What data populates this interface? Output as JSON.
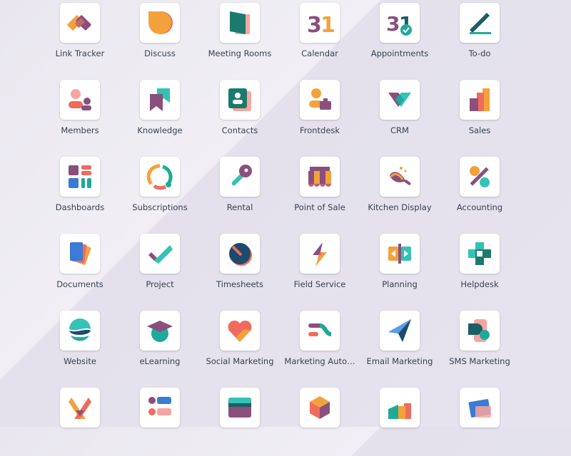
{
  "apps": [
    {
      "label": "Link Tracker",
      "icon": "link-tracker-icon"
    },
    {
      "label": "Discuss",
      "icon": "discuss-icon"
    },
    {
      "label": "Meeting Rooms",
      "icon": "meeting-rooms-icon"
    },
    {
      "label": "Calendar",
      "icon": "calendar-icon"
    },
    {
      "label": "Appointments",
      "icon": "appointments-icon"
    },
    {
      "label": "To-do",
      "icon": "todo-icon"
    },
    {
      "label": "Members",
      "icon": "members-icon"
    },
    {
      "label": "Knowledge",
      "icon": "knowledge-icon"
    },
    {
      "label": "Contacts",
      "icon": "contacts-icon"
    },
    {
      "label": "Frontdesk",
      "icon": "frontdesk-icon"
    },
    {
      "label": "CRM",
      "icon": "crm-icon"
    },
    {
      "label": "Sales",
      "icon": "sales-icon"
    },
    {
      "label": "Dashboards",
      "icon": "dashboards-icon"
    },
    {
      "label": "Subscriptions",
      "icon": "subscriptions-icon"
    },
    {
      "label": "Rental",
      "icon": "rental-icon"
    },
    {
      "label": "Point of Sale",
      "icon": "point-of-sale-icon"
    },
    {
      "label": "Kitchen Display",
      "icon": "kitchen-display-icon"
    },
    {
      "label": "Accounting",
      "icon": "accounting-icon"
    },
    {
      "label": "Documents",
      "icon": "documents-icon"
    },
    {
      "label": "Project",
      "icon": "project-icon"
    },
    {
      "label": "Timesheets",
      "icon": "timesheets-icon"
    },
    {
      "label": "Field Service",
      "icon": "field-service-icon"
    },
    {
      "label": "Planning",
      "icon": "planning-icon"
    },
    {
      "label": "Helpdesk",
      "icon": "helpdesk-icon"
    },
    {
      "label": "Website",
      "icon": "website-icon"
    },
    {
      "label": "eLearning",
      "icon": "elearning-icon"
    },
    {
      "label": "Social Marketing",
      "icon": "social-marketing-icon"
    },
    {
      "label": "Marketing Auto…",
      "icon": "marketing-automation-icon"
    },
    {
      "label": "Email Marketing",
      "icon": "email-marketing-icon"
    },
    {
      "label": "SMS Marketing",
      "icon": "sms-marketing-icon"
    },
    {
      "label": "",
      "icon": "events-icon"
    },
    {
      "label": "",
      "icon": "surveys-icon"
    },
    {
      "label": "",
      "icon": "payments-icon"
    },
    {
      "label": "",
      "icon": "inventory-icon"
    },
    {
      "label": "",
      "icon": "manufacturing-icon"
    },
    {
      "label": "",
      "icon": "plm-icon"
    }
  ],
  "colors": {
    "purple": "#8a4f7d",
    "teal": "#1fa99a",
    "orange": "#f3a23b",
    "red": "#f06b5c",
    "dark": "#1b5e63",
    "lightteal": "#33c2b6"
  }
}
